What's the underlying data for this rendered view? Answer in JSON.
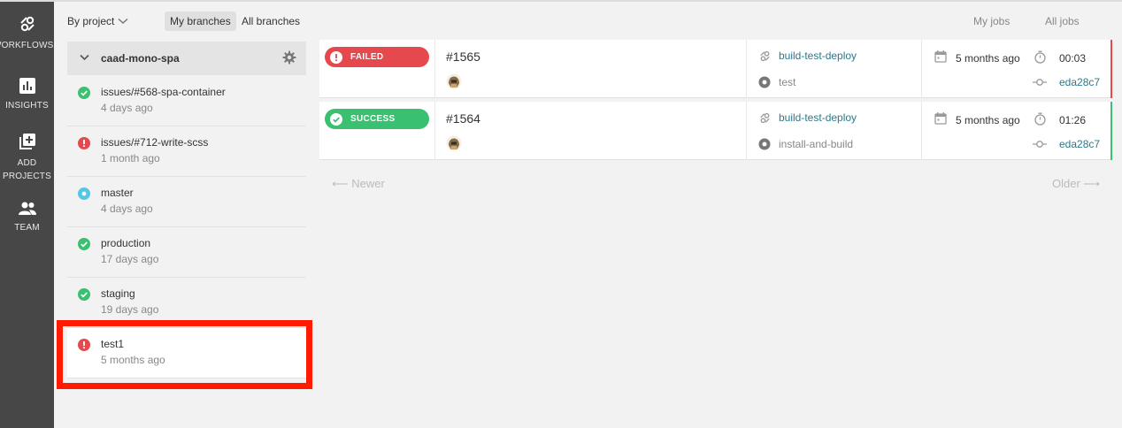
{
  "nav": {
    "items": [
      {
        "label": "WORKFLOWS",
        "icon": "workflows-icon"
      },
      {
        "label": "INSIGHTS",
        "icon": "insights-icon"
      },
      {
        "label": "ADD\nPROJECTS",
        "icon": "add-projects-icon"
      },
      {
        "label": "TEAM",
        "icon": "team-icon"
      }
    ]
  },
  "filters": {
    "by_project": "By project",
    "my_branches": "My branches",
    "all_branches": "All branches",
    "my_jobs": "My jobs",
    "all_jobs": "All jobs"
  },
  "project": {
    "name": "caad-mono-spa"
  },
  "branches": [
    {
      "name": "issues/#568-spa-container",
      "time": "4 days ago",
      "status": "success"
    },
    {
      "name": "issues/#712-write-scss",
      "time": "1 month ago",
      "status": "failed"
    },
    {
      "name": "master",
      "time": "4 days ago",
      "status": "running"
    },
    {
      "name": "production",
      "time": "17 days ago",
      "status": "success"
    },
    {
      "name": "staging",
      "time": "19 days ago",
      "status": "success"
    },
    {
      "name": "test1",
      "time": "5 months ago",
      "status": "failed"
    }
  ],
  "jobs": [
    {
      "status": "FAILED",
      "number": "#1565",
      "workflow": "build-test-deploy",
      "job": "test",
      "time_ago": "5 months ago",
      "duration": "00:03",
      "commit": "eda28c7"
    },
    {
      "status": "SUCCESS",
      "number": "#1564",
      "workflow": "build-test-deploy",
      "job": "install-and-build",
      "time_ago": "5 months ago",
      "duration": "01:26",
      "commit": "eda28c7"
    }
  ],
  "pagination": {
    "newer": "⟵ Newer",
    "older": "Older ⟶"
  },
  "colors": {
    "failed": "#e5484d",
    "success": "#39c070",
    "running": "#55c7e6",
    "link": "#2a7a8c",
    "highlight": "#ff1a00",
    "rail": "#474747"
  }
}
